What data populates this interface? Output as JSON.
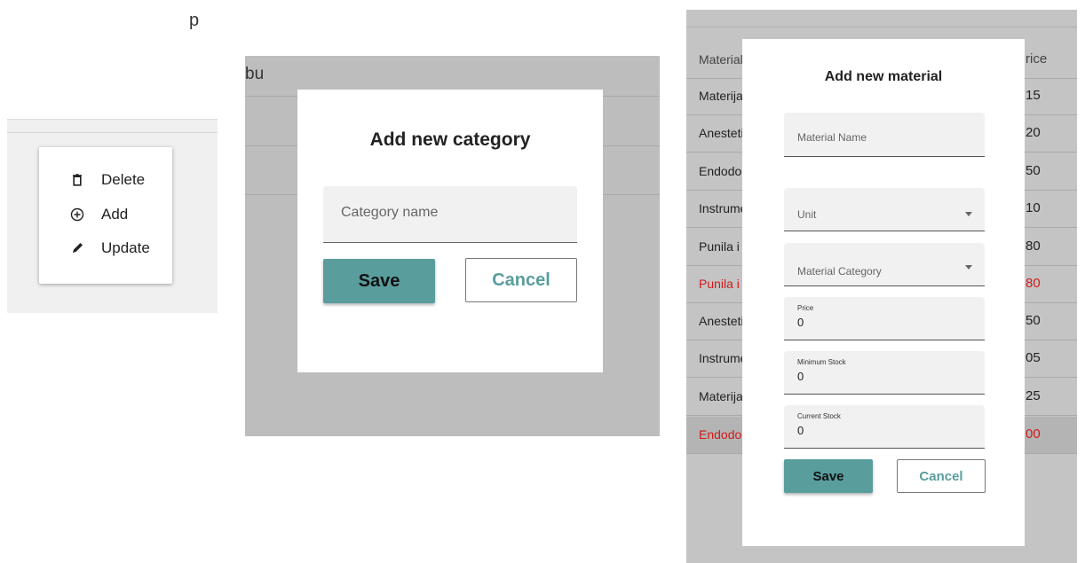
{
  "top_partial_text": "p",
  "context_menu": {
    "items": [
      {
        "icon": "trash-icon",
        "label": "Delete"
      },
      {
        "icon": "add-circle-icon",
        "label": "Add"
      },
      {
        "icon": "pencil-icon",
        "label": "Update"
      }
    ]
  },
  "category_dialog": {
    "background_header_fragment": "bu",
    "title": "Add new category",
    "field_placeholder": "Category name",
    "save_label": "Save",
    "cancel_label": "Cancel"
  },
  "material_dialog": {
    "title": "Add new material",
    "material_name_placeholder": "Material Name",
    "unit_placeholder": "Unit",
    "category_placeholder": "Material Category",
    "price_label": "Price",
    "price_value": "0",
    "min_stock_label": "Minimum Stock",
    "min_stock_value": "0",
    "current_stock_label": "Current Stock",
    "current_stock_value": "0",
    "save_label": "Save",
    "cancel_label": "Cancel"
  },
  "background_table": {
    "header": {
      "col1": "Material",
      "col2": "rice"
    },
    "rows": [
      {
        "col1": "Materijal",
        "col2": "15",
        "status": "normal"
      },
      {
        "col1": "Anesteti",
        "col2": "20",
        "status": "normal"
      },
      {
        "col1": "Endodor",
        "col2": "50",
        "status": "normal"
      },
      {
        "col1": "Instrume",
        "col2": "10",
        "status": "normal"
      },
      {
        "col1": "Punila i k",
        "col2": "80",
        "status": "normal"
      },
      {
        "col1": "Punila i k",
        "col2": "80",
        "status": "low"
      },
      {
        "col1": "Anesteti",
        "col2": "50",
        "status": "normal"
      },
      {
        "col1": "Instrume",
        "col2": "05",
        "status": "normal"
      },
      {
        "col1": "Materijal",
        "col2": "25",
        "status": "normal"
      },
      {
        "col1": "Endodor",
        "col2": "00",
        "status": "low-selected"
      }
    ]
  },
  "colors": {
    "primary": "#5a9d9d",
    "overlay": "#bdbdbd",
    "low_stock_text": "#d11a1a"
  }
}
